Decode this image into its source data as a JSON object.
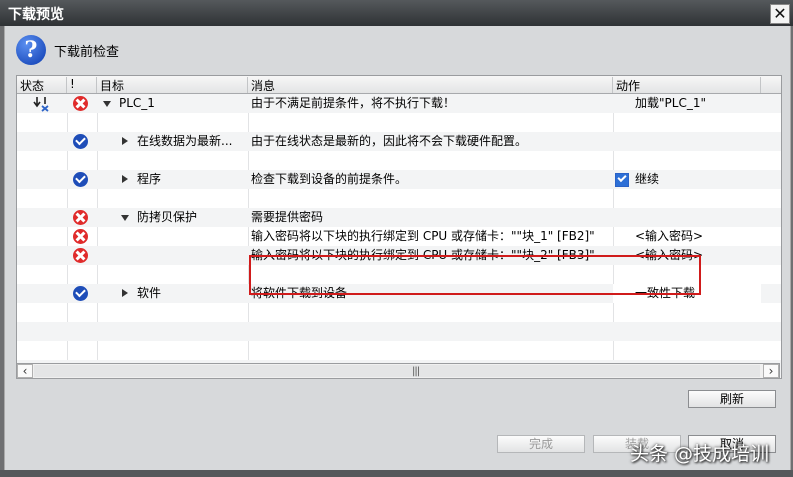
{
  "window": {
    "title": "下载预览",
    "close_label": "✕"
  },
  "header": {
    "text": "下载前检查",
    "icon": "question-icon"
  },
  "columns": [
    "状态",
    "!",
    "目标",
    "消息",
    "动作"
  ],
  "rows": [
    {
      "status_icon": "download-icon",
      "check": "error",
      "expand": "down",
      "target": "PLC_1",
      "message": "由于不满足前提条件，将不执行下载！",
      "action": "加载\"PLC_1\""
    },
    {
      "check": "ok",
      "expand": "right",
      "target": "在线数据为最新...",
      "message": "由于在线状态是最新的，因此将不会下载硬件配置。",
      "action": ""
    },
    {
      "check": "ok",
      "expand": "right",
      "target": "程序",
      "message": "检查下载到设备的前提条件。",
      "action": "继续",
      "action_checkbox": true
    },
    {
      "check": "error",
      "expand": "down",
      "target": "防拷贝保护",
      "message": "需要提供密码",
      "action": ""
    },
    {
      "check": "error",
      "target": "",
      "message": "输入密码将以下块的执行绑定到 CPU 或存储卡：\"\"块_1\" [FB2]\"",
      "action": "<输入密码>"
    },
    {
      "check": "error",
      "target": "",
      "message": "输入密码将以下块的执行绑定到 CPU 或存储卡：\"\"块_2\" [FB3]\"",
      "action": "<输入密码>"
    },
    {
      "check": "ok",
      "expand": "right",
      "target": "软件",
      "message": "将软件下载到设备",
      "action": "一致性下载"
    }
  ],
  "buttons": {
    "refresh": "刷新",
    "finish": "完成",
    "load": "装载",
    "cancel": "取消"
  },
  "watermark": "头条 @技成培训",
  "colors": {
    "error": "#e02b2b",
    "ok": "#1e4db8",
    "highlight": "#d01b1b"
  }
}
